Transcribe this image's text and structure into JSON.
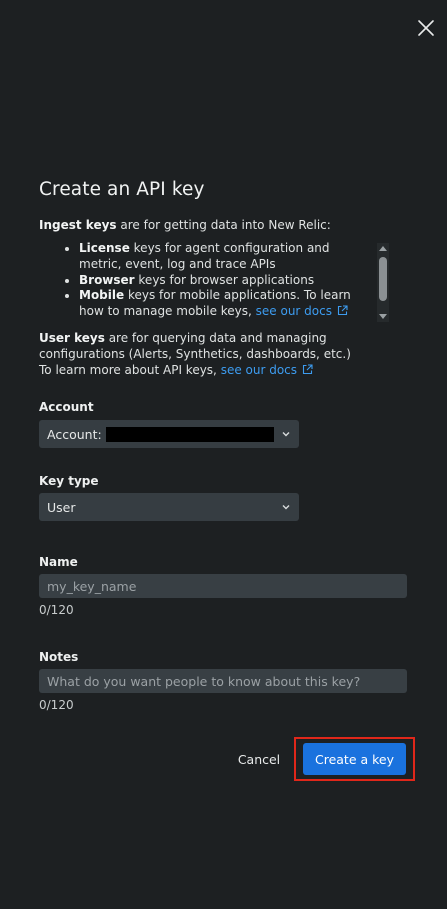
{
  "dialog": {
    "title": "Create an API key",
    "close_icon": "close-icon"
  },
  "description": {
    "ingest_bold": "Ingest keys",
    "ingest_rest": " are for getting data into New Relic:",
    "list": [
      {
        "bold": "License",
        "text": " keys for agent configuration and metric, event, log and trace APIs"
      },
      {
        "bold": "Browser",
        "text": " keys for browser applications"
      },
      {
        "bold": "Mobile",
        "text": " keys for mobile applications. To learn how to manage mobile keys, ",
        "link": "see our docs"
      }
    ],
    "user_bold": "User keys",
    "user_rest": " are for querying data and managing configurations (Alerts, Synthetics, dashboards, etc.)",
    "learn_more": "To learn more about API keys, ",
    "learn_more_link": "see our docs"
  },
  "form": {
    "account": {
      "label": "Account",
      "value_prefix": "Account:"
    },
    "key_type": {
      "label": "Key type",
      "value": "User"
    },
    "name": {
      "label": "Name",
      "placeholder": "my_key_name",
      "counter": "0/120"
    },
    "notes": {
      "label": "Notes",
      "placeholder": "What do you want people to know about this key?",
      "counter": "0/120"
    }
  },
  "actions": {
    "cancel": "Cancel",
    "create": "Create a key"
  },
  "colors": {
    "background": "#1d2022",
    "link": "#3d9cf0",
    "primary_button": "#1a72de",
    "highlight_border": "#e0271a"
  }
}
